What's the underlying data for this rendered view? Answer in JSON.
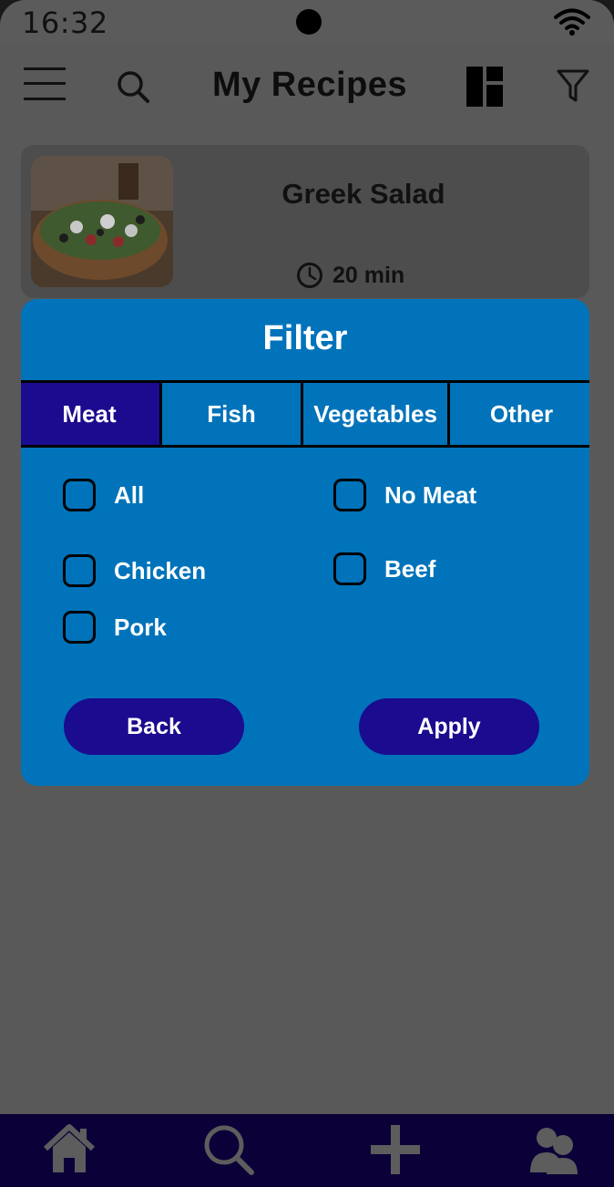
{
  "status_bar": {
    "time": "16:32"
  },
  "app_bar": {
    "title": "My Recipes"
  },
  "recipe_card": {
    "name": "Greek Salad",
    "time": "20 min"
  },
  "filter_modal": {
    "title": "Filter",
    "tabs": [
      {
        "label": "Meat",
        "active": true
      },
      {
        "label": "Fish",
        "active": false
      },
      {
        "label": "Vegetables",
        "active": false
      },
      {
        "label": "Other",
        "active": false
      }
    ],
    "options": [
      {
        "label": "All",
        "checked": false
      },
      {
        "label": "No Meat",
        "checked": false
      },
      {
        "label": "Chicken",
        "checked": false
      },
      {
        "label": "Beef",
        "checked": false
      },
      {
        "label": "Pork",
        "checked": false
      }
    ],
    "back_label": "Back",
    "apply_label": "Apply"
  },
  "colors": {
    "overlay_gray": "#595959",
    "modal_blue": "#0073ba",
    "accent_indigo": "#1a0b8f",
    "nav_bg": "#0c0038"
  },
  "icons": {
    "menu": "hamburger-menu-icon",
    "search": "search-icon",
    "layout": "layout-grid-icon",
    "filter": "filter-funnel-icon",
    "clock": "clock-icon",
    "nav_home": "home-icon",
    "nav_search": "search-icon",
    "nav_add": "plus-icon",
    "nav_profile": "users-icon"
  }
}
